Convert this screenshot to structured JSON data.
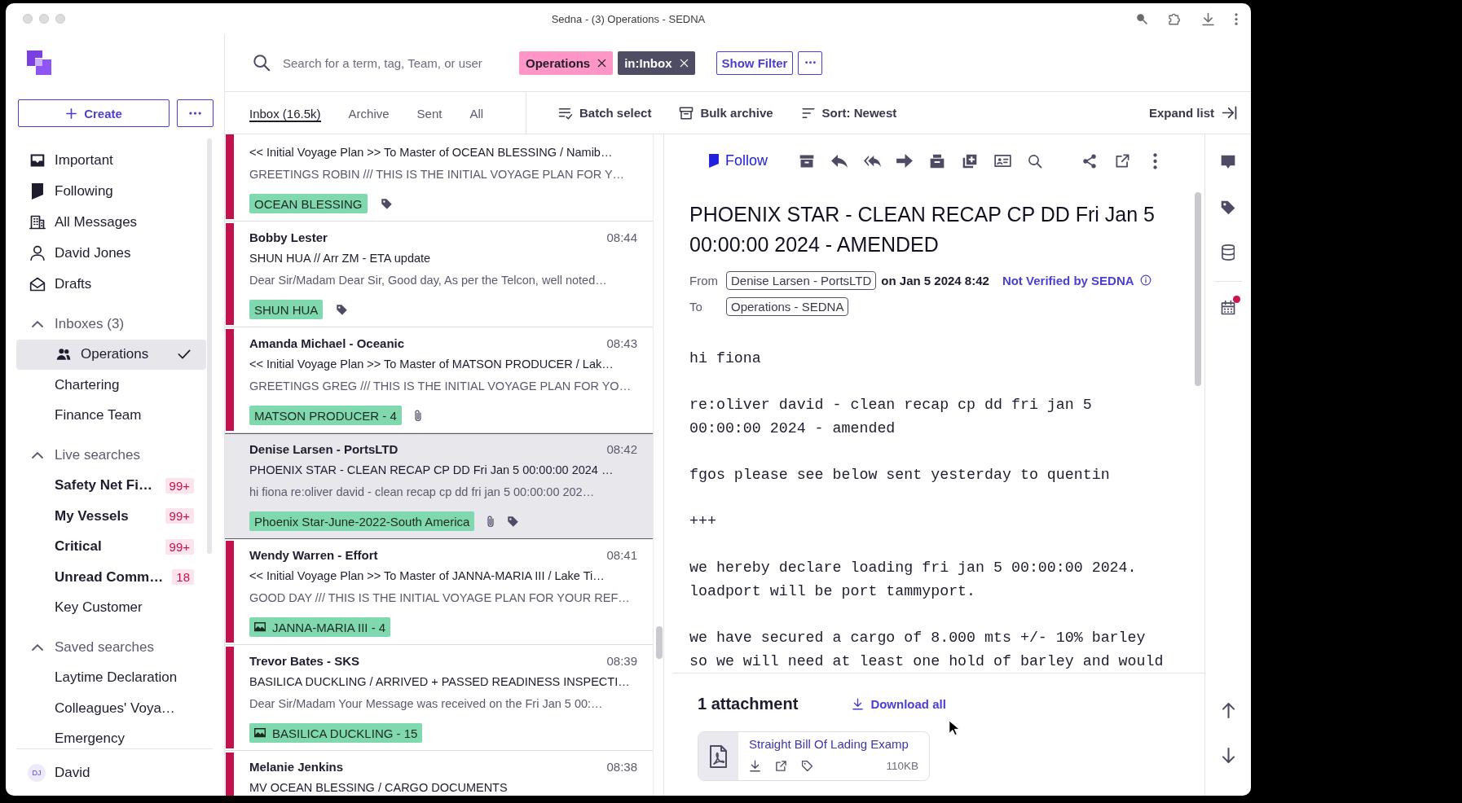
{
  "window": {
    "title": "Sedna - (3) Operations - SEDNA"
  },
  "sidebar": {
    "create": "Create",
    "nav": [
      {
        "label": "Important"
      },
      {
        "label": "Following"
      },
      {
        "label": "All Messages"
      },
      {
        "label": "David Jones"
      },
      {
        "label": "Drafts"
      }
    ],
    "sections": [
      {
        "title": "Inboxes (3)",
        "expanded": true,
        "items": [
          {
            "label": "Operations",
            "selected": true,
            "unread": false
          },
          {
            "label": "Chartering",
            "selected": false,
            "unread": false
          },
          {
            "label": "Finance Team",
            "selected": false,
            "unread": false
          }
        ]
      },
      {
        "title": "Live searches",
        "expanded": true,
        "items": [
          {
            "label": "Safety Net Fi…",
            "selected": false,
            "unread": true,
            "badge": "99+"
          },
          {
            "label": "My Vessels",
            "selected": false,
            "unread": true,
            "badge": "99+"
          },
          {
            "label": "Critical",
            "selected": false,
            "unread": true,
            "badge": "99+"
          },
          {
            "label": "Unread Comm…",
            "selected": false,
            "unread": true,
            "badge": "18"
          },
          {
            "label": "Key Customer",
            "selected": false,
            "unread": false
          }
        ]
      },
      {
        "title": "Saved searches",
        "expanded": true,
        "items": [
          {
            "label": "Laytime Declaration",
            "selected": false,
            "unread": false
          },
          {
            "label": "Colleagues' Voya…",
            "selected": false,
            "unread": false
          },
          {
            "label": "Emergency",
            "selected": false,
            "unread": false
          }
        ]
      }
    ],
    "user": {
      "initials": "DJ",
      "name": "David"
    }
  },
  "search": {
    "placeholder": "Search for a term, tag, Team, or user",
    "filters": [
      {
        "label": "Operations",
        "color": "#ff96c5"
      },
      {
        "label": "in:Inbox",
        "color": "#4f4d64"
      }
    ],
    "show_filter": "Show Filter"
  },
  "tabs": [
    {
      "label": "Inbox (16.5k)",
      "selected": true
    },
    {
      "label": "Archive",
      "selected": false
    },
    {
      "label": "Sent",
      "selected": false
    },
    {
      "label": "All",
      "selected": false
    }
  ],
  "list_actions": [
    {
      "label": "Batch select"
    },
    {
      "label": "Bulk archive"
    },
    {
      "label": "Sort: Newest"
    }
  ],
  "expand_list": "Expand list",
  "messages": [
    {
      "subject": "<< Initial Voyage Plan >> To Master of OCEAN BLESSING / Namib…",
      "preview": "GREETINGS ROBIN /// THIS IS THE INITIAL VOYAGE PLAN FOR Y…",
      "tag": "OCEAN BLESSING",
      "has_image": false,
      "has_attachment": false,
      "tagged": true,
      "unread": true,
      "selected": false
    },
    {
      "sender": "Bobby Lester",
      "time": "08:44",
      "subject": "SHUN HUA // Arr ZM - ETA update",
      "preview": "Dear Sir/Madam Dear Sir, Good day, As per the Telcon, well noted…",
      "tag": "SHUN HUA",
      "has_image": false,
      "has_attachment": false,
      "tagged": true,
      "unread": true,
      "selected": false
    },
    {
      "sender": "Amanda Michael - Oceanic",
      "time": "08:43",
      "subject": "<< Initial Voyage Plan >> To Master of MATSON PRODUCER / Lak…",
      "preview": "GREETINGS GREG /// THIS IS THE INITIAL VOYAGE PLAN FOR YO…",
      "tag": "MATSON PRODUCER - 4",
      "has_image": false,
      "has_attachment": true,
      "tagged": false,
      "unread": true,
      "selected": false
    },
    {
      "sender": "Denise Larsen - PortsLTD",
      "time": "08:42",
      "subject": "PHOENIX STAR - CLEAN RECAP CP DD Fri Jan 5 00:00:00 2024 …",
      "preview": "hi fiona re:oliver david - clean recap cp dd fri jan 5 00:00:00 202…",
      "tag": "Phoenix Star-June-2022-South America",
      "has_image": false,
      "has_attachment": true,
      "tagged": true,
      "unread": false,
      "selected": true
    },
    {
      "sender": "Wendy Warren - Effort",
      "time": "08:41",
      "subject": "<< Initial Voyage Plan >> To Master of JANNA-MARIA III / Lake Ti…",
      "preview": "GOOD DAY /// THIS IS THE INITIAL VOYAGE PLAN FOR YOUR REF…",
      "tag": "JANNA-MARIA III - 4",
      "has_image": true,
      "has_attachment": false,
      "tagged": false,
      "unread": true,
      "selected": false
    },
    {
      "sender": "Trevor Bates - SKS",
      "time": "08:39",
      "subject": "BASILICA DUCKLING / ARRIVED + PASSED READINESS INSPECTI…",
      "preview": "Dear Sir/Madam Your Message was received on the Fri Jan 5 00:…",
      "tag": "BASILICA DUCKLING - 15",
      "has_image": true,
      "has_attachment": false,
      "tagged": false,
      "unread": true,
      "selected": false
    },
    {
      "sender": "Melanie Jenkins",
      "time": "08:38",
      "subject": "MV OCEAN BLESSING / CARGO DOCUMENTS",
      "has_image": false,
      "has_attachment": false,
      "tagged": false,
      "unread": true,
      "selected": false
    }
  ],
  "reader": {
    "follow": "Follow",
    "subject": "PHOENIX STAR - CLEAN RECAP CP DD Fri Jan 5 00:00:00 2024 - AMENDED",
    "from_label": "From",
    "from": "Denise Larsen - PortsLTD",
    "date": "on Jan 5 2024 8:42",
    "verification": "Not Verified by SEDNA",
    "to_label": "To",
    "to": "Operations - SEDNA",
    "body": [
      "hi fiona",
      "re:oliver david - clean recap cp dd fri jan 5\n00:00:00 2024 - amended",
      "fgos please see below sent yesterday to quentin",
      "+++",
      "we hereby declare loading fri jan 5 00:00:00 2024.\nloadport will be port tammyport.",
      "we have secured a cargo of 8.000 mts +/- 10% barley\nso we will need at least one hold of barley and would"
    ],
    "attachments_title": "1 attachment",
    "download_all": "Download all",
    "attachments": [
      {
        "name": "Straight Bill Of Lading Examp",
        "size": "110KB"
      }
    ]
  },
  "rail": {
    "calendar_notification": true
  }
}
